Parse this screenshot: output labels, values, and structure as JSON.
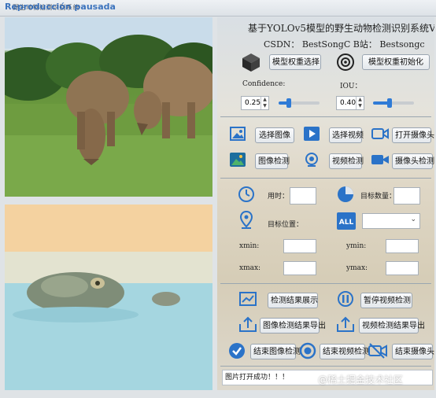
{
  "window": {
    "overlay_label": "Reproducción pausada",
    "title": "野生动物检测识别系统"
  },
  "header": {
    "title": "基于YOLOv5模型的野生动物检测识别系统V1.0",
    "csdn": "CSDN：  BestSongC   B站：  Bestsongc"
  },
  "model": {
    "select_weights": "模型权重选择",
    "init_weights": "模型权重初始化",
    "confidence_label": "Confidence:",
    "iou_label": "IOU：",
    "confidence_value": "0.25",
    "iou_value": "0.40",
    "confidence_level": 0.25,
    "iou_level": 0.4
  },
  "sources": {
    "select_image": "选择图像",
    "select_video": "选择视频",
    "open_camera": "打开摄像头",
    "image_detect": "图像检测",
    "video_detect": "视频检测",
    "camera_detect": "摄像头检测"
  },
  "results": {
    "time_label": "用时：",
    "count_label": "目标数量：",
    "position_label": "目标位置：",
    "xmin": "xmin:",
    "ymin": "ymin:",
    "xmax": "xmax:",
    "ymax": "ymax:"
  },
  "actions": {
    "show_results": "检测结果展示",
    "pause_video": "暂停视频检测",
    "export_image": "图像检测结果导出",
    "export_video": "视频检测结果导出",
    "end_image": "结束图像检测",
    "end_video": "结束视频检测",
    "end_camera": "结束摄像头"
  },
  "status_text": "图片打开成功！！！",
  "site_watermark": "@稀土掘金技术社区",
  "colors": {
    "accent": "#2f7bd6",
    "bar": "#2b73c8"
  }
}
